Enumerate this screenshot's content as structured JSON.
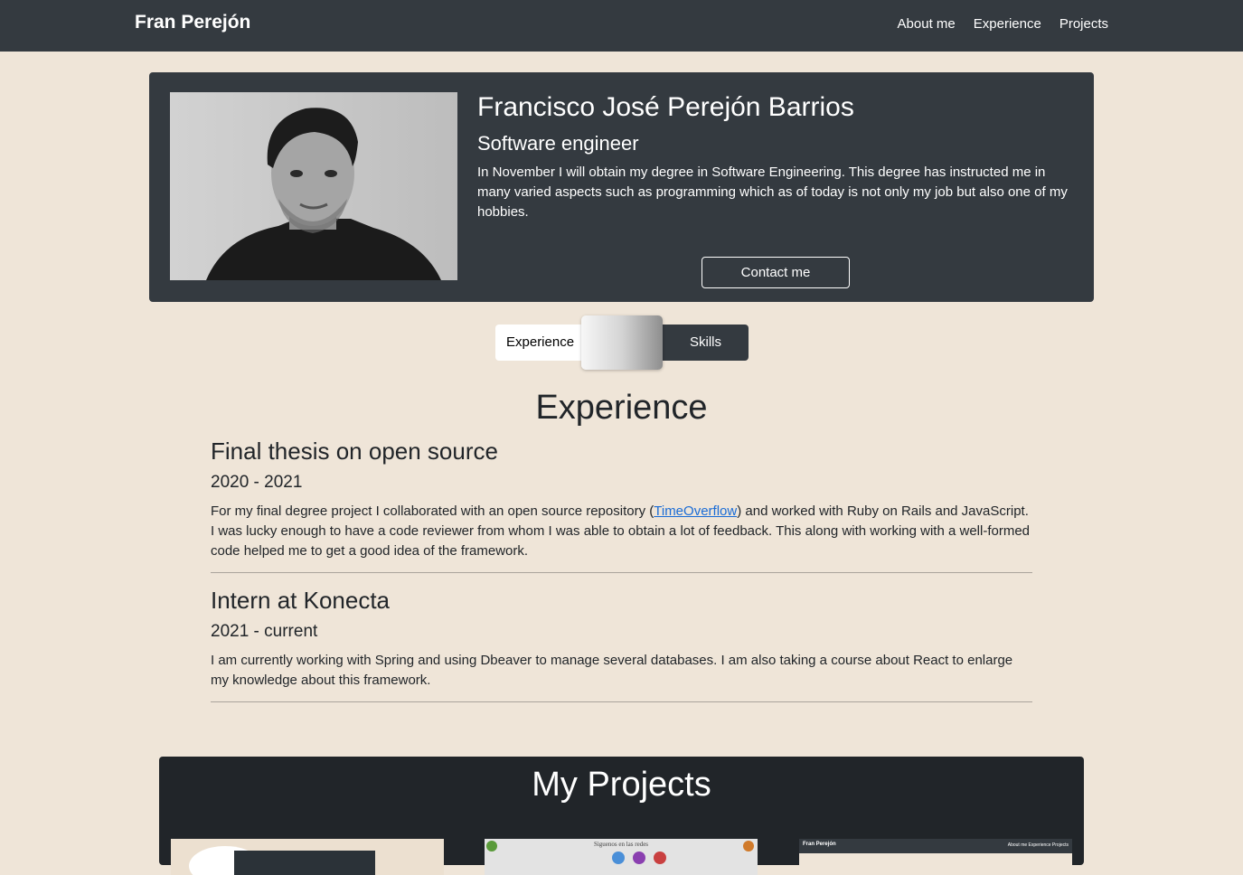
{
  "nav": {
    "brand": "Fran Perejón",
    "links": [
      "About me",
      "Experience",
      "Projects"
    ]
  },
  "hero": {
    "name": "Francisco José Perejón Barrios",
    "role": "Software engineer",
    "bio": "In November I will obtain my degree in Software Engineering. This degree has instructed me in many varied aspects such as programming which as of today is not only my job but also one of my hobbies.",
    "contact_label": "Contact me"
  },
  "toggle": {
    "left_label": "Experience",
    "right_label": "Skills"
  },
  "experience": {
    "title": "Experience",
    "items": [
      {
        "title": "Final thesis on open source",
        "period": "2020 - 2021",
        "desc_before": "For my final degree project I collaborated with an open source repository (",
        "link_text": "TimeOverflow",
        "desc_after": ") and worked with Ruby on Rails and JavaScript. I was lucky enough to have a code reviewer from whom I was able to obtain a lot of feedback. This along with working with a well-formed code helped me to get a good idea of the framework."
      },
      {
        "title": "Intern at Konecta",
        "period": "2021 - current",
        "desc": "I am currently working with Spring and using Dbeaver to manage several databases. I am also taking a course about React to enlarge my knowledge about this framework."
      }
    ]
  },
  "projects": {
    "title": "My Projects",
    "card2_text": "Siguenos en las redes",
    "card3_brand": "Fran Perejón",
    "card3_links": "About me   Experience   Projects"
  },
  "colors": {
    "background": "#efe5d8",
    "navbar": "#343a40",
    "projects_panel": "#212529",
    "link": "#1a6cd6"
  }
}
